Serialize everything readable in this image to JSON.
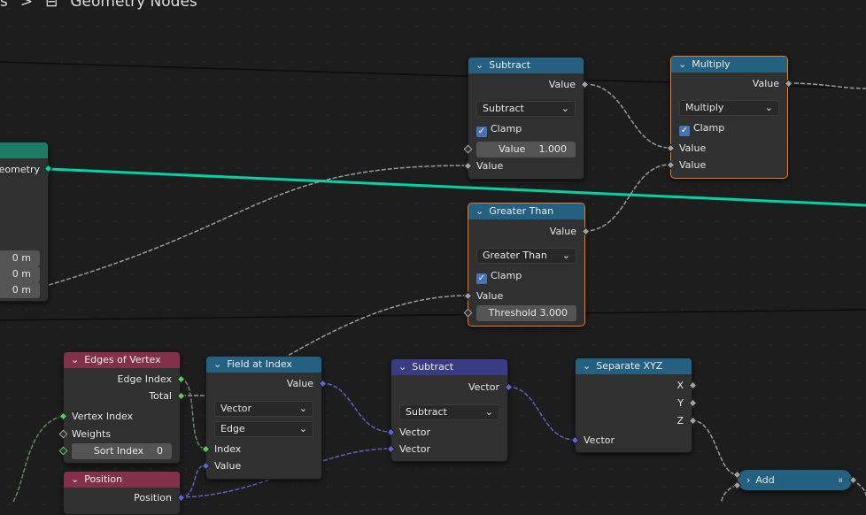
{
  "breadcrumb": {
    "prev": "s",
    "separator": ">",
    "icon": "node-tree-icon",
    "current": "Geometry Nodes"
  },
  "colors": {
    "geometry_wire": "#00d6a3",
    "vector_socket": "#6363c7",
    "int_socket": "#63c763",
    "float_socket": "#a1a1a1",
    "selected": "#f07b1a"
  },
  "group_input": {
    "output": "Geometry",
    "fields": [
      "0 m",
      "0 m",
      "0 m"
    ]
  },
  "subtract_math": {
    "title": "Subtract",
    "output": "Value",
    "operation": "Subtract",
    "clamp": "Clamp",
    "field_label": "Value",
    "field_value": "1.000",
    "input": "Value"
  },
  "multiply": {
    "title": "Multiply",
    "output": "Value",
    "operation": "Multiply",
    "clamp": "Clamp",
    "input1": "Value",
    "input2": "Value"
  },
  "greater_than": {
    "title": "Greater Than",
    "output": "Value",
    "operation": "Greater Than",
    "clamp": "Clamp",
    "input": "Value",
    "field_label": "Threshold",
    "field_value": "3.000"
  },
  "edges_of_vertex": {
    "title": "Edges of Vertex",
    "out1": "Edge Index",
    "out2": "Total",
    "in1": "Vertex Index",
    "in2": "Weights",
    "field_label": "Sort Index",
    "field_value": "0"
  },
  "position": {
    "title": "Position",
    "output": "Position"
  },
  "field_at_index": {
    "title": "Field at Index",
    "output": "Value",
    "type": "Vector",
    "domain": "Edge",
    "in1": "Index",
    "in2": "Value"
  },
  "subtract_vector": {
    "title": "Subtract",
    "output": "Vector",
    "operation": "Subtract",
    "in1": "Vector",
    "in2": "Vector"
  },
  "separate_xyz": {
    "title": "Separate XYZ",
    "out_x": "X",
    "out_y": "Y",
    "out_z": "Z",
    "input": "Vector"
  },
  "add": {
    "title": "Add"
  }
}
